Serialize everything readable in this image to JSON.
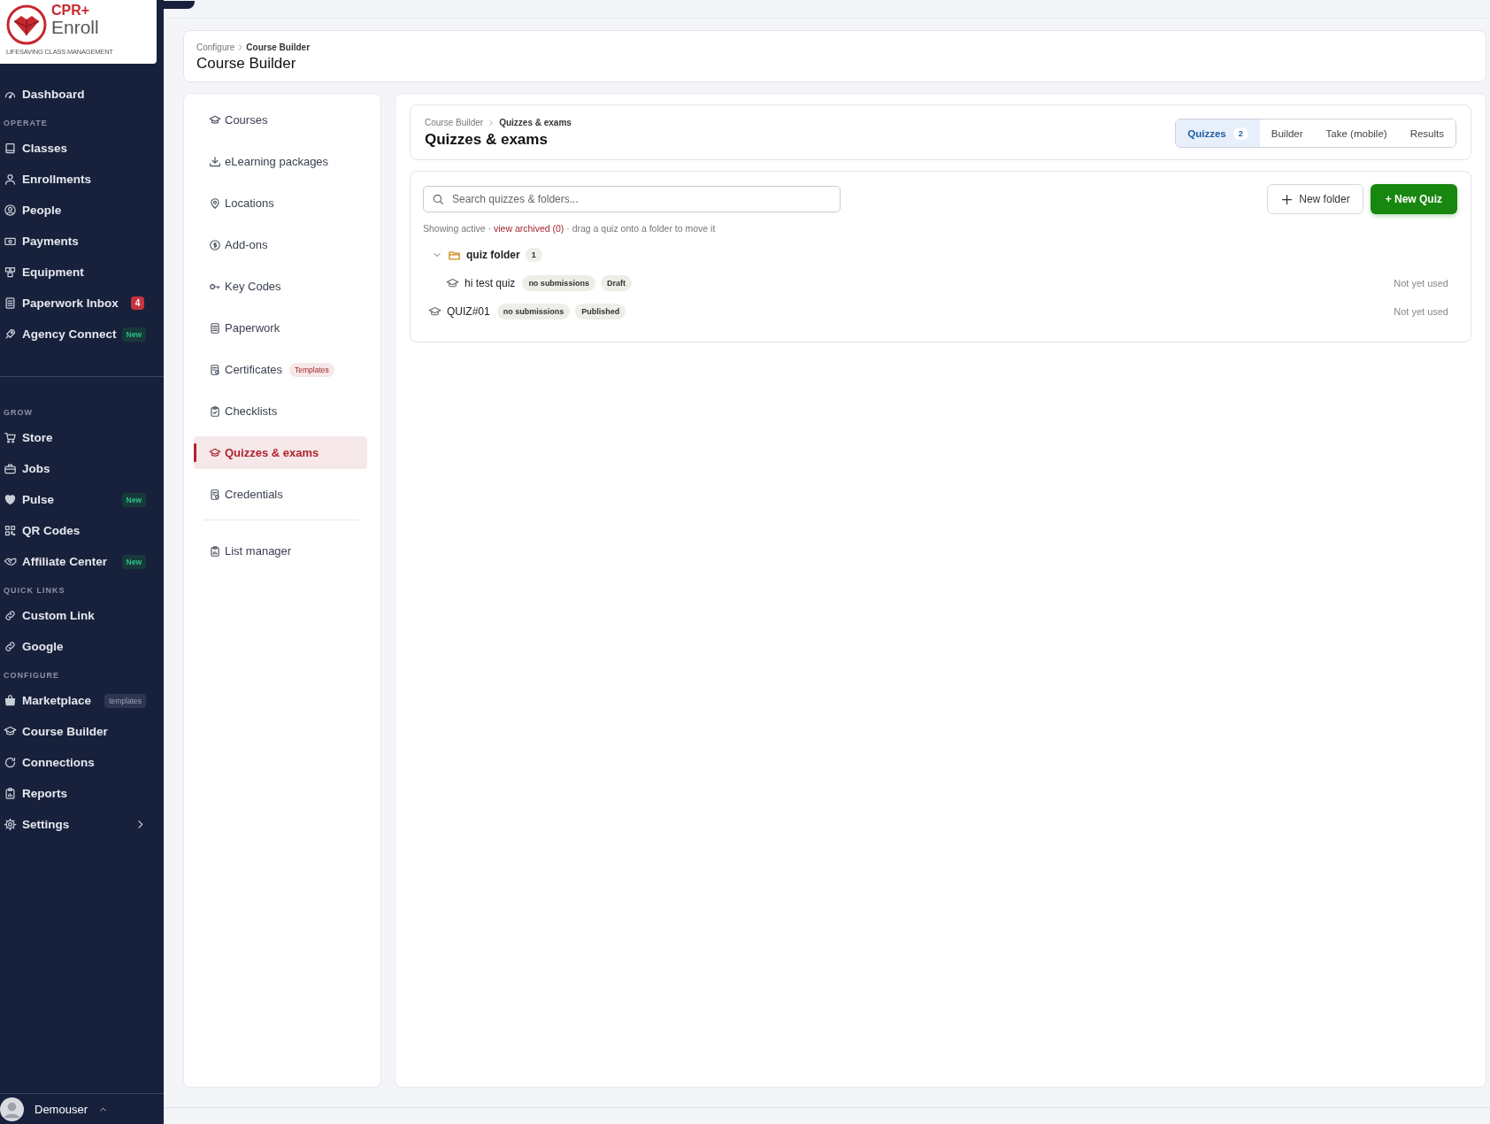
{
  "brand": {
    "name_top": "CPR+",
    "name_bottom": "Enroll",
    "tagline": "LIFESAVING CLASS MANAGEMENT"
  },
  "sidebar": {
    "sections": [
      {
        "items": [
          {
            "label": "Dashboard",
            "selected": false
          }
        ]
      },
      {
        "heading": "OPERATE",
        "items": [
          {
            "label": "Classes",
            "selected": false
          },
          {
            "label": "Enrollments",
            "selected": false
          },
          {
            "label": "People",
            "selected": false
          },
          {
            "label": "Payments",
            "selected": false
          },
          {
            "label": "Equipment",
            "selected": false
          },
          {
            "label": "Paperwork Inbox",
            "selected": false,
            "badge": {
              "text": "4",
              "kind": "count"
            }
          },
          {
            "label": "Agency Connect",
            "selected": false,
            "badge": {
              "text": "New",
              "kind": "new"
            }
          }
        ]
      },
      {
        "heading": "GROW",
        "separated": true,
        "items": [
          {
            "label": "Store",
            "selected": false
          },
          {
            "label": "Jobs",
            "selected": false
          },
          {
            "label": "Pulse",
            "selected": false,
            "badge": {
              "text": "New",
              "kind": "new"
            }
          },
          {
            "label": "QR Codes",
            "selected": false
          },
          {
            "label": "Affiliate Center",
            "selected": false,
            "badge": {
              "text": "New",
              "kind": "new"
            }
          }
        ]
      },
      {
        "heading": "QUICK LINKS",
        "items": [
          {
            "label": "Custom Link",
            "selected": false
          },
          {
            "label": "Google",
            "selected": false
          }
        ]
      },
      {
        "heading": "CONFIGURE",
        "items": [
          {
            "label": "Marketplace",
            "selected": false,
            "badge": {
              "text": "templates",
              "kind": "tag"
            }
          },
          {
            "label": "Course Builder",
            "selected": false
          },
          {
            "label": "Connections",
            "selected": false
          },
          {
            "label": "Reports",
            "selected": false
          },
          {
            "label": "Settings",
            "selected": false,
            "submenu": true
          }
        ]
      }
    ],
    "user": {
      "name": "Demouser"
    }
  },
  "header": {
    "breadcrumb": [
      "Configure",
      "Course Builder"
    ],
    "title": "Course Builder"
  },
  "config_nav": {
    "items": [
      {
        "label": "Courses",
        "selected": false
      },
      {
        "label": "eLearning packages",
        "selected": false
      },
      {
        "label": "Locations",
        "selected": false
      },
      {
        "label": "Add-ons",
        "selected": false
      },
      {
        "label": "Key Codes",
        "selected": false
      },
      {
        "label": "Paperwork",
        "selected": false
      },
      {
        "label": "Certificates",
        "selected": false,
        "badge": "Templates"
      },
      {
        "label": "Checklists",
        "selected": false
      },
      {
        "label": "Quizzes & exams",
        "selected": true
      },
      {
        "label": "Credentials",
        "selected": false
      }
    ],
    "footer_items": [
      {
        "label": "List manager",
        "selected": false
      }
    ]
  },
  "quiz_panel": {
    "breadcrumb": [
      "Course Builder",
      "Quizzes & exams"
    ],
    "title": "Quizzes & exams",
    "tabs": [
      {
        "label": "Quizzes",
        "count": "2",
        "selected": true
      },
      {
        "label": "Builder",
        "selected": false
      },
      {
        "label": "Take (mobile)",
        "selected": false
      },
      {
        "label": "Results",
        "selected": false
      }
    ],
    "search": {
      "placeholder": "Search quizzes & folders..."
    },
    "buttons": {
      "new_folder": "New folder",
      "new_quiz": "+ New Quiz"
    },
    "notice": {
      "prefix": "Showing active ·",
      "link": "view archived (0)",
      "suffix": "· drag a quiz onto a folder to move it"
    },
    "tree": [
      {
        "kind": "folder",
        "name": "quiz folder",
        "count": "1",
        "expanded": true,
        "children": [
          {
            "kind": "quiz",
            "name": "hi test quiz",
            "tags": [
              "no submissions",
              "Draft"
            ],
            "usage": "Not yet used"
          }
        ]
      },
      {
        "kind": "quiz",
        "name": "QUIZ#01",
        "tags": [
          "no submissions",
          "Published"
        ],
        "usage": "Not yet used"
      }
    ]
  }
}
